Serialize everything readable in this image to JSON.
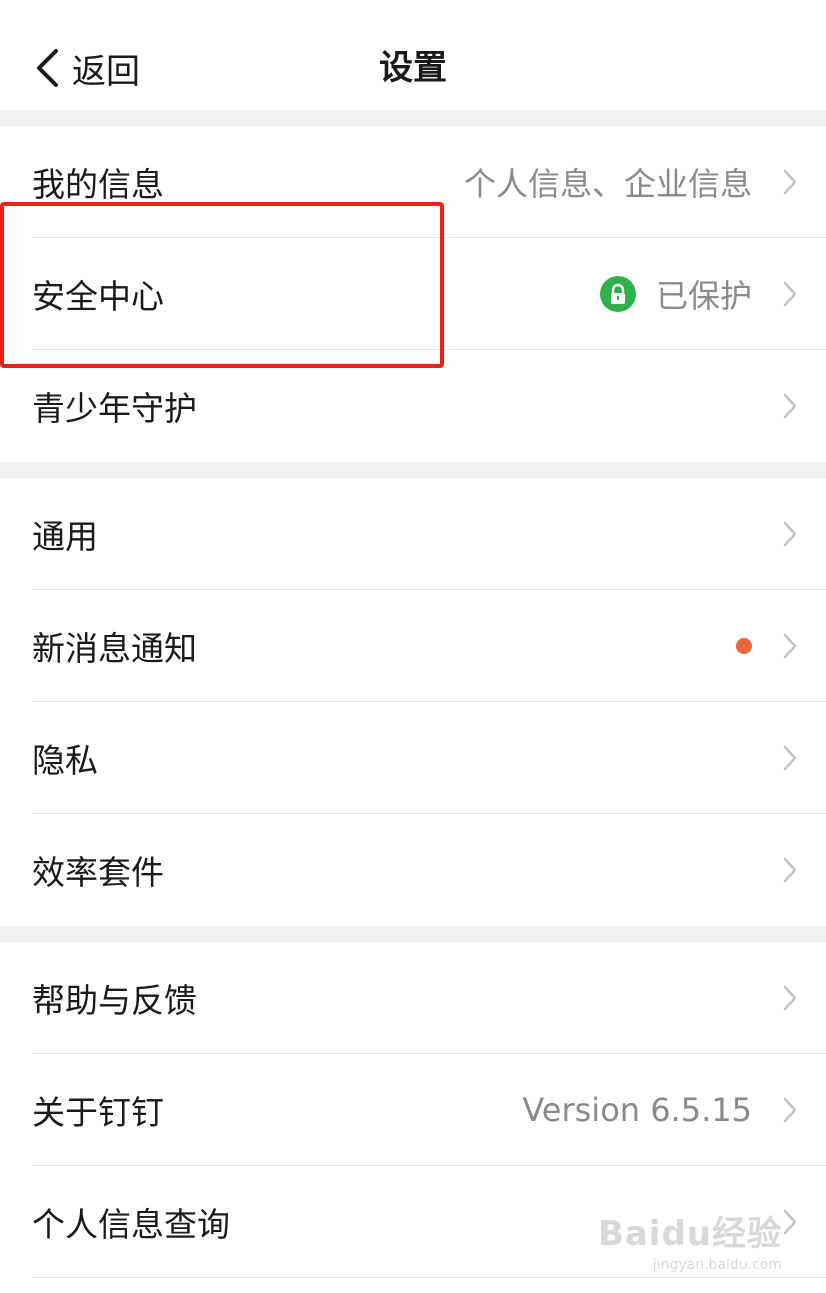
{
  "nav": {
    "back_label": "返回",
    "title": "设置"
  },
  "groups": [
    {
      "items": [
        {
          "label": "我的信息",
          "value": "个人信息、企业信息"
        },
        {
          "label": "安全中心",
          "value": "已保护",
          "icon": "lock-icon",
          "icon_color": "#2fb14b"
        },
        {
          "label": "青少年守护",
          "value": ""
        }
      ]
    },
    {
      "items": [
        {
          "label": "通用",
          "value": ""
        },
        {
          "label": "新消息通知",
          "value": "",
          "badge": "dot",
          "badge_color": "#e8673c"
        },
        {
          "label": "隐私",
          "value": ""
        },
        {
          "label": "效率套件",
          "value": ""
        }
      ]
    },
    {
      "items": [
        {
          "label": "帮助与反馈",
          "value": ""
        },
        {
          "label": "关于钉钉",
          "value": "Version 6.5.15"
        },
        {
          "label": "个人信息查询",
          "value": ""
        }
      ]
    }
  ],
  "annotation": {
    "highlight_color": "#e8221b"
  },
  "watermark": {
    "main": "Baidu经验",
    "sub": "jingyan.baidu.com"
  }
}
